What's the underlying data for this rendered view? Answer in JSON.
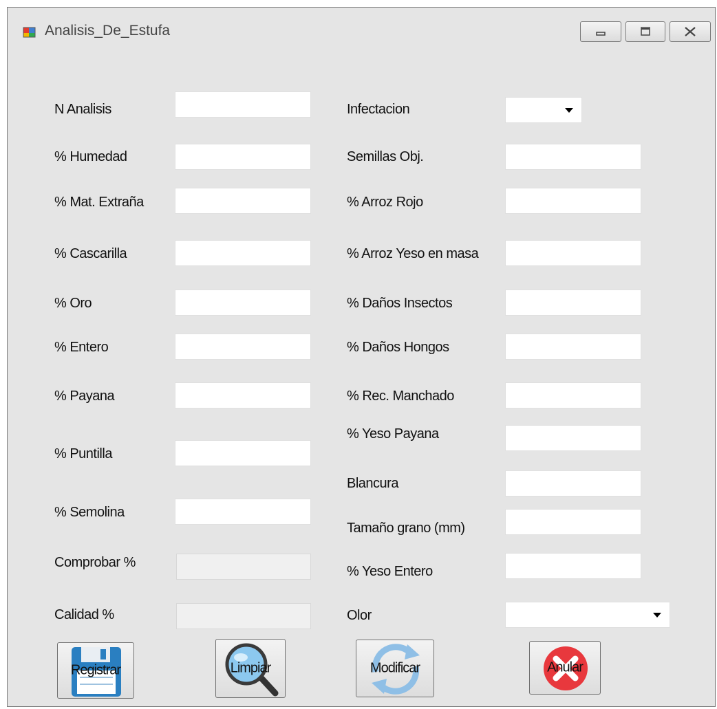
{
  "window": {
    "title": "Analisis_De_Estufa",
    "icon": "winforms-app-icon",
    "controls": [
      "minimize-icon",
      "maximize-icon",
      "close-icon"
    ]
  },
  "left_fields": [
    {
      "label": "N Analisis",
      "value": "",
      "readonly": false
    },
    {
      "label": "% Humedad",
      "value": "",
      "readonly": false
    },
    {
      "label": "% Mat. Extraña",
      "value": "",
      "readonly": false
    },
    {
      "label": "% Cascarilla",
      "value": "",
      "readonly": false
    },
    {
      "label": "% Oro",
      "value": "",
      "readonly": false
    },
    {
      "label": "% Entero",
      "value": "",
      "readonly": false
    },
    {
      "label": "% Payana",
      "value": "",
      "readonly": false
    },
    {
      "label": "% Puntilla",
      "value": "",
      "readonly": false
    },
    {
      "label": "% Semolina",
      "value": "",
      "readonly": false
    },
    {
      "label": "Comprobar %",
      "value": "",
      "readonly": true
    },
    {
      "label": "Calidad %",
      "value": "",
      "readonly": true
    }
  ],
  "right_fields": [
    {
      "label": "Infectacion",
      "type": "combo",
      "value": ""
    },
    {
      "label": "Semillas Obj.",
      "type": "text",
      "value": ""
    },
    {
      "label": "% Arroz Rojo",
      "type": "text",
      "value": ""
    },
    {
      "label": "% Arroz Yeso en masa",
      "type": "text",
      "value": ""
    },
    {
      "label": "% Daños Insectos",
      "type": "text",
      "value": ""
    },
    {
      "label": "% Daños Hongos",
      "type": "text",
      "value": ""
    },
    {
      "label": "% Rec. Manchado",
      "type": "text",
      "value": ""
    },
    {
      "label": "% Yeso Payana",
      "type": "text",
      "value": ""
    },
    {
      "label": "Blancura",
      "type": "text",
      "value": ""
    },
    {
      "label": "Tamaño grano (mm)",
      "type": "text",
      "value": ""
    },
    {
      "label": "% Yeso Entero",
      "type": "text",
      "value": ""
    },
    {
      "label": "Olor",
      "type": "combo",
      "value": ""
    }
  ],
  "buttons": [
    {
      "label": "Registrar",
      "icon": "floppy-disk-icon"
    },
    {
      "label": "Limpiar",
      "icon": "magnifier-icon"
    },
    {
      "label": "Modificar",
      "icon": "refresh-arrows-icon"
    },
    {
      "label": "Anular",
      "icon": "cancel-x-icon"
    }
  ],
  "colors": {
    "window_bg": "#e5e5e5",
    "input_bg": "#ffffff",
    "readonly_bg": "#f0f0f0",
    "cancel_red": "#e8383d",
    "floppy_blue": "#2a7fc1"
  }
}
